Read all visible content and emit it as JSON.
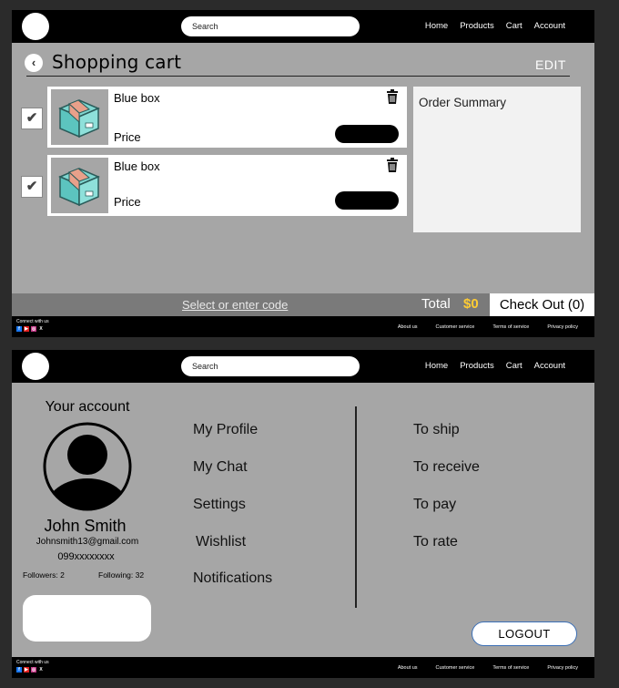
{
  "nav": {
    "search_placeholder": "Search",
    "links": [
      "Home",
      "Products",
      "Cart",
      "Account"
    ]
  },
  "footer": {
    "connect": "Connect with us",
    "socials": [
      "facebook-icon",
      "youtube-icon",
      "instagram-icon",
      "x-icon"
    ],
    "x_glyph": "X",
    "links": [
      "About us",
      "Customer service",
      "Terms of service",
      "Privacy policy"
    ]
  },
  "cart": {
    "title": "Shopping cart",
    "edit": "EDIT",
    "items": [
      {
        "name": "Blue box",
        "price_label": "Price",
        "checked": true
      },
      {
        "name": "Blue box",
        "price_label": "Price",
        "checked": true
      }
    ],
    "order_summary": "Order Summary",
    "promo": "Select or enter code",
    "total_label": "Total",
    "total_value": "$0",
    "checkout": "Check Out (0)"
  },
  "account": {
    "title": "Your account",
    "name": "John Smith",
    "email": "Johnsmith13@gmail.com",
    "phone": "099xxxxxxxx",
    "followers": "Followers: 2",
    "following": "Following: 32",
    "menu_left": [
      "My Profile",
      "My Chat",
      "Settings",
      "Wishlist",
      "Notifications"
    ],
    "menu_right": [
      "To ship",
      "To receive",
      "To pay",
      "To rate"
    ],
    "logout": "LOGOUT"
  },
  "colors": {
    "background": "#2b2b2b",
    "panel": "#a6a6a6",
    "bar": "#000000",
    "total_accent": "#ffcc33",
    "logout_border": "#3b6fb6"
  }
}
